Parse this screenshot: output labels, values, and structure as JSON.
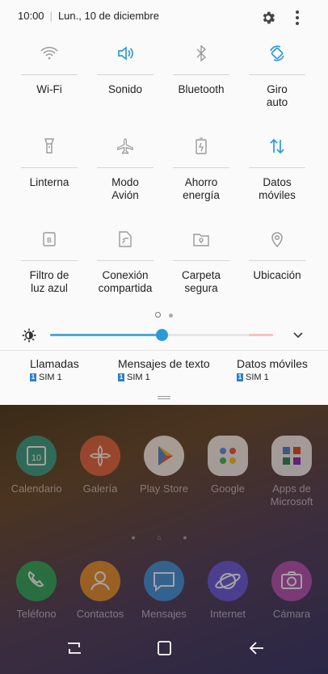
{
  "status": {
    "time": "10:00",
    "date": "Lun., 10 de diciembre"
  },
  "tiles": [
    {
      "id": "wifi",
      "label": "Wi-Fi",
      "icon": "wifi-icon",
      "active": false
    },
    {
      "id": "sound",
      "label": "Sonido",
      "icon": "speaker-icon",
      "active": true
    },
    {
      "id": "bluetooth",
      "label": "Bluetooth",
      "icon": "bluetooth-icon",
      "active": false
    },
    {
      "id": "rotate",
      "label": "Giro\nauto",
      "icon": "auto-rotate-icon",
      "active": true
    },
    {
      "id": "flashlight",
      "label": "Linterna",
      "icon": "flashlight-icon",
      "active": false
    },
    {
      "id": "airplane",
      "label": "Modo\nAvión",
      "icon": "airplane-icon",
      "active": false
    },
    {
      "id": "power",
      "label": "Ahorro\nenergía",
      "icon": "battery-saver-icon",
      "active": false
    },
    {
      "id": "data",
      "label": "Datos\nmóviles",
      "icon": "mobile-data-icon",
      "active": true
    },
    {
      "id": "bluelight",
      "label": "Filtro de\nluz azul",
      "icon": "blue-light-filter-icon",
      "active": false
    },
    {
      "id": "hotspot",
      "label": "Conexión\ncompartida",
      "icon": "hotspot-icon",
      "active": false
    },
    {
      "id": "folder",
      "label": "Carpeta\nsegura",
      "icon": "secure-folder-icon",
      "active": false
    },
    {
      "id": "location",
      "label": "Ubicación",
      "icon": "location-icon",
      "active": false
    }
  ],
  "brightness": {
    "level": 0.5
  },
  "sim": [
    {
      "title": "Llamadas",
      "sim": "SIM 1",
      "badge": "1"
    },
    {
      "title": "Mensajes de texto",
      "sim": "SIM 1",
      "badge": "1"
    },
    {
      "title": "Datos móviles",
      "sim": "SIM 1",
      "badge": "1"
    }
  ],
  "apps": [
    {
      "name": "Calendario",
      "icon": "calendar-icon",
      "color": "#1e9b8a",
      "badge": "10"
    },
    {
      "name": "Galería",
      "icon": "gallery-icon",
      "color": "#d9573a"
    },
    {
      "name": "Play Store",
      "icon": "play-store-icon",
      "color": "#f2f2f2"
    },
    {
      "name": "Google",
      "icon": "google-folder-icon",
      "color": "#f2f2f2"
    },
    {
      "name": "Apps de\nMicrosoft",
      "icon": "microsoft-folder-icon",
      "color": "#f2f2f2"
    }
  ],
  "dock": [
    {
      "name": "Teléfono",
      "icon": "phone-icon",
      "color": "#17a34a"
    },
    {
      "name": "Contactos",
      "icon": "contacts-icon",
      "color": "#e58a13"
    },
    {
      "name": "Mensajes",
      "icon": "messages-icon",
      "color": "#2c8fd0"
    },
    {
      "name": "Internet",
      "icon": "internet-icon",
      "color": "#5a4fd0"
    },
    {
      "name": "Cámara",
      "icon": "camera-icon",
      "color": "#b447a0"
    }
  ],
  "colors": {
    "accent": "#2b9ad9",
    "inactive": "#9a9a9a"
  }
}
